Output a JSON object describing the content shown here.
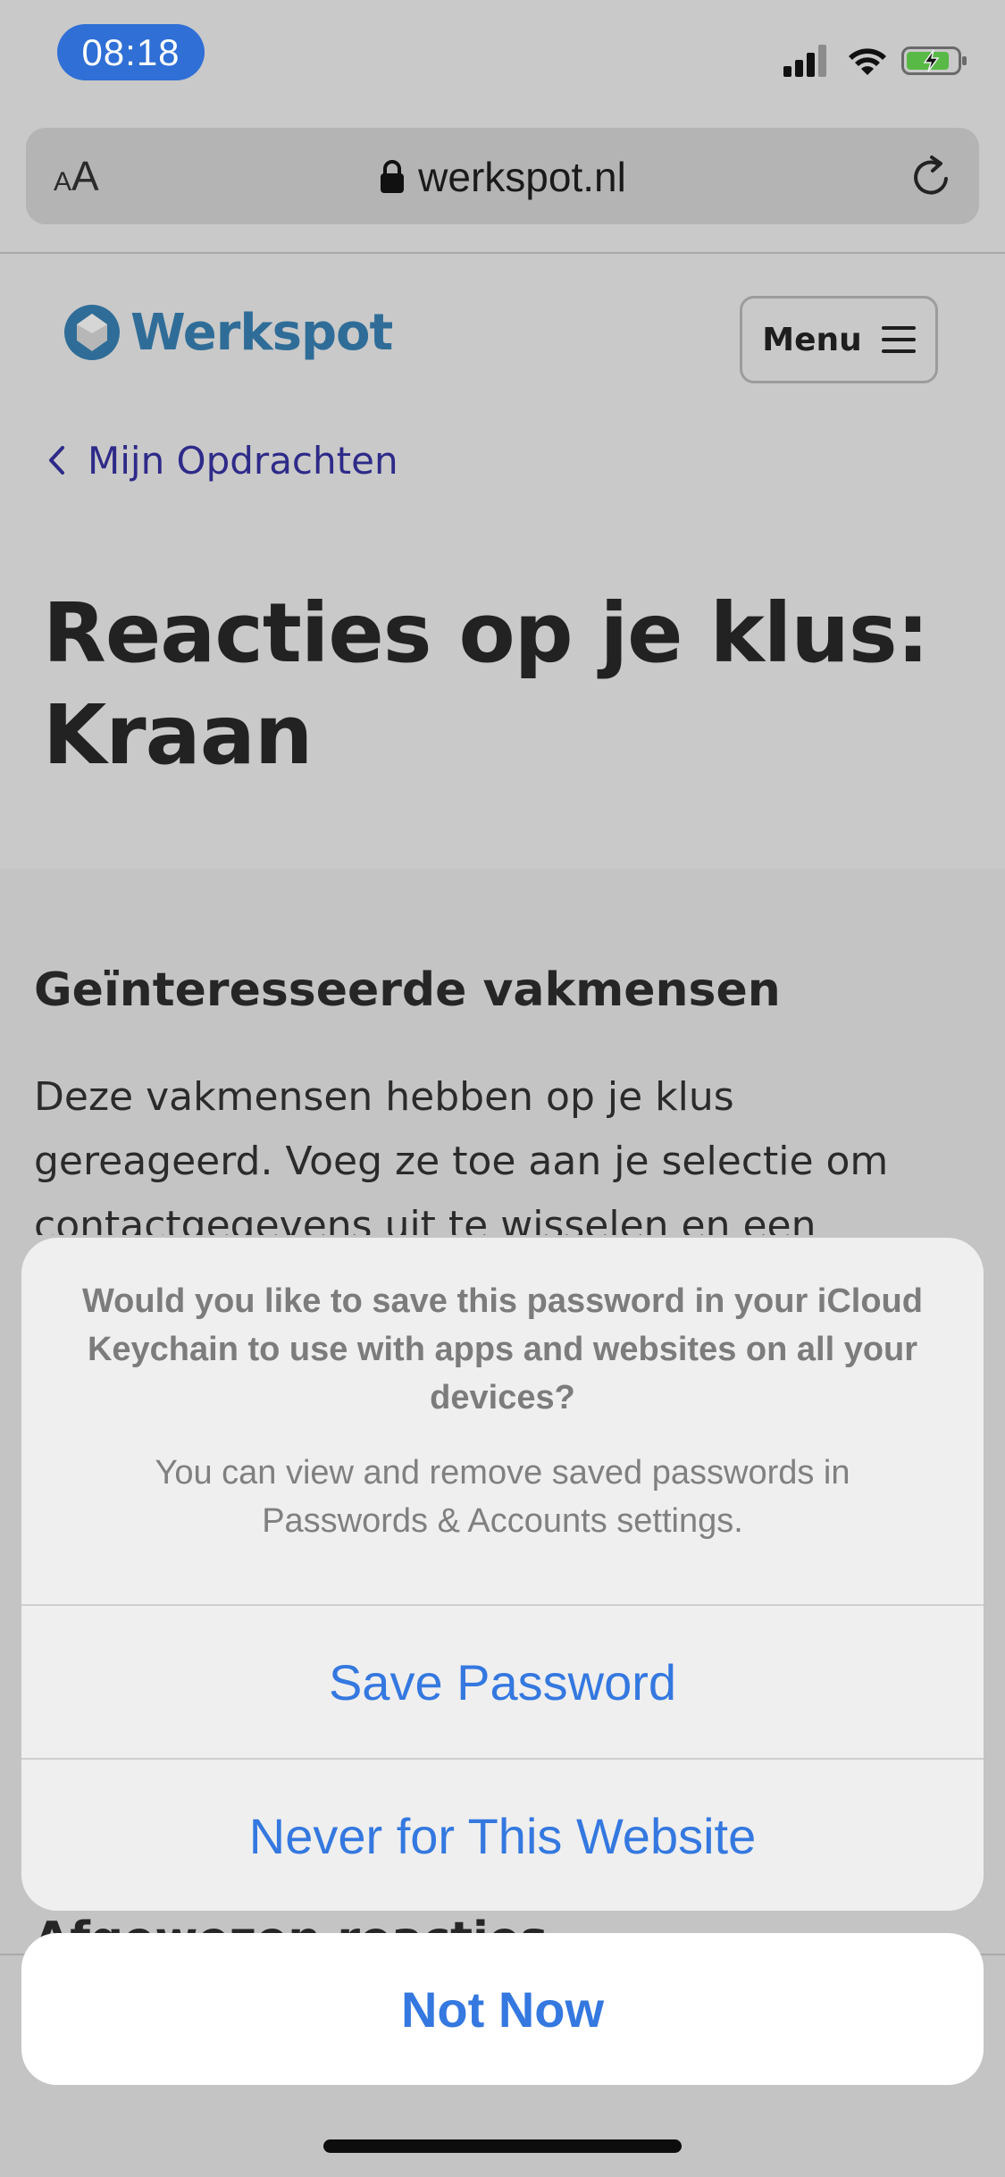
{
  "status_bar": {
    "time": "08:18"
  },
  "browser": {
    "text_size_small": "A",
    "text_size_big": "A",
    "url": "werkspot.nl"
  },
  "page": {
    "logo_text": "Werkspot",
    "menu_label": "Menu",
    "back_link": "Mijn Opdrachten",
    "title": "Reacties op je klus: Kraan",
    "section_heading": "Geïnteresseerde vakmensen",
    "section_text": "Deze vakmensen hebben op je klus gereageerd. Voeg ze toe aan je selectie om contactgegevens uit te wisselen en een",
    "partial_heading": "Afgewezen reacties"
  },
  "action_sheet": {
    "title": "Would you like to save this password in your iCloud Keychain to use with apps and websites on all your devices?",
    "subtitle": "You can view and remove saved passwords in Passwords & Accounts settings.",
    "save_label": "Save Password",
    "never_label": "Never for This Website",
    "not_now_label": "Not Now"
  },
  "colors": {
    "accent_blue": "#3478e0",
    "time_pill": "#2f6fd6",
    "link_purple": "#2e2a89",
    "logo_blue": "#2f6d98"
  }
}
